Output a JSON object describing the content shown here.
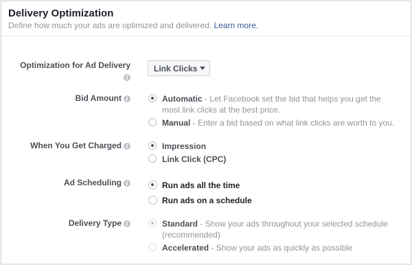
{
  "header": {
    "title": "Delivery Optimization",
    "subtitle": "Define how much your ads are optimized and delivered.",
    "learn_more": "Learn more."
  },
  "optimization": {
    "label": "Optimization for Ad Delivery",
    "value": "Link Clicks"
  },
  "bid_amount": {
    "label": "Bid Amount",
    "options": [
      {
        "title": "Automatic",
        "desc_line1": " - Let Facebook set the bid that helps you get the",
        "desc_line2": "most link clicks at the best price.",
        "selected": true
      },
      {
        "title": "Manual",
        "desc_line1": " - Enter a bid based on what link clicks are worth to you.",
        "selected": false
      }
    ]
  },
  "charged": {
    "label": "When You Get Charged",
    "options": [
      {
        "title": "Impression",
        "selected": true
      },
      {
        "title": "Link Click (CPC)",
        "selected": false
      }
    ]
  },
  "scheduling": {
    "label": "Ad Scheduling",
    "options": [
      {
        "title": "Run ads all the time",
        "selected": true
      },
      {
        "title": "Run ads on a schedule",
        "selected": false
      }
    ]
  },
  "delivery_type": {
    "label": "Delivery Type",
    "options": [
      {
        "title": "Standard",
        "desc_line1": " - Show your ads throughout your selected schedule",
        "desc_line2": "(recommended)",
        "selected": true
      },
      {
        "title": "Accelerated",
        "desc_line1": " - Show your ads as quickly as possible",
        "selected": false
      }
    ]
  },
  "icons": {
    "info": "info-icon",
    "caret": "caret-down-icon"
  },
  "colors": {
    "link": "#365899",
    "muted": "#90949c",
    "label": "#4b4f56"
  }
}
